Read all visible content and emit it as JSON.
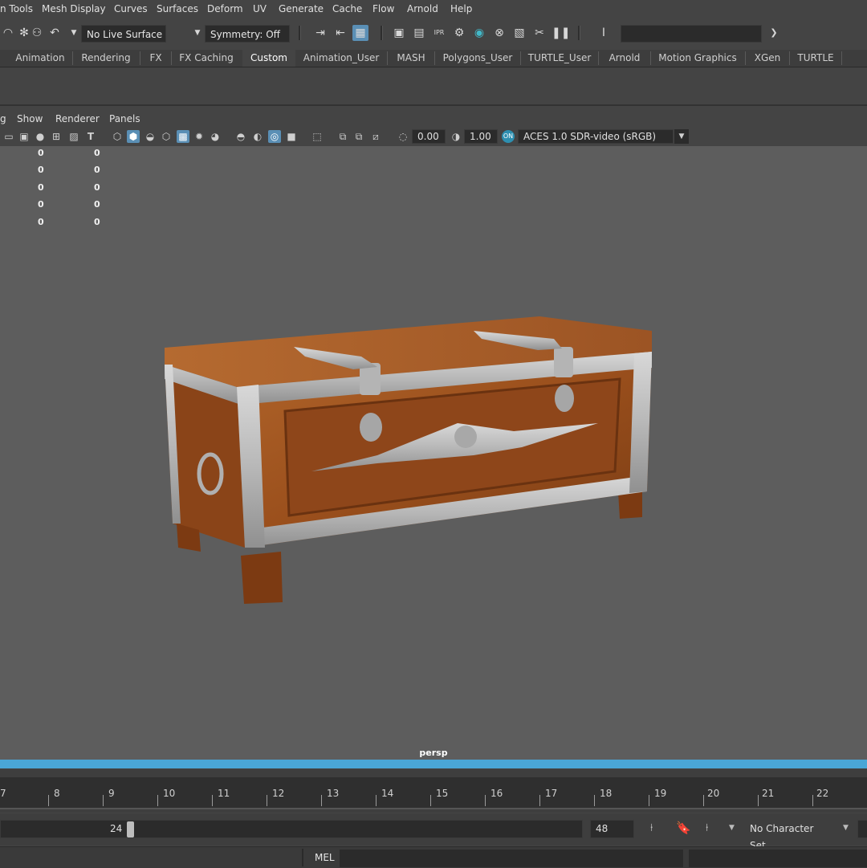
{
  "menu": [
    "n Tools",
    "Mesh Display",
    "Curves",
    "Surfaces",
    "Deform",
    "UV",
    "Generate",
    "Cache",
    "Flow",
    "Arnold",
    "Help"
  ],
  "toolbar": {
    "live_surface": "No Live Surface",
    "symmetry": "Symmetry: Off"
  },
  "shelf_tabs": [
    "Animation",
    "Rendering",
    "FX",
    "FX Caching",
    "Custom",
    "Animation_User",
    "MASH",
    "Polygons_User",
    "TURTLE_User",
    "Arnold",
    "Motion Graphics",
    "XGen",
    "TURTLE"
  ],
  "shelf_active": "Custom",
  "panel_menu": [
    "g",
    "Show",
    "Renderer",
    "Panels"
  ],
  "panel_tools": {
    "exposure": "0.00",
    "gamma": "1.00",
    "color_space": "ACES 1.0 SDR-video (sRGB)"
  },
  "hud_values": [
    [
      "0",
      "0"
    ],
    [
      "0",
      "0"
    ],
    [
      "0",
      "0"
    ],
    [
      "0",
      "0"
    ],
    [
      "0",
      "0"
    ]
  ],
  "camera": "persp",
  "timeline": {
    "ticks": [
      "7",
      "8",
      "9",
      "10",
      "11",
      "12",
      "13",
      "14",
      "15",
      "16",
      "17",
      "18",
      "19",
      "20",
      "21",
      "22"
    ]
  },
  "range": {
    "end_playback": "24",
    "end_anim": "48",
    "character_set": "No Character Set"
  },
  "command_line": {
    "mode": "MEL"
  },
  "colors": {
    "accent": "#4aa6d6",
    "viewport_bg": "#5d5d5d",
    "ui_bg": "#444444"
  }
}
